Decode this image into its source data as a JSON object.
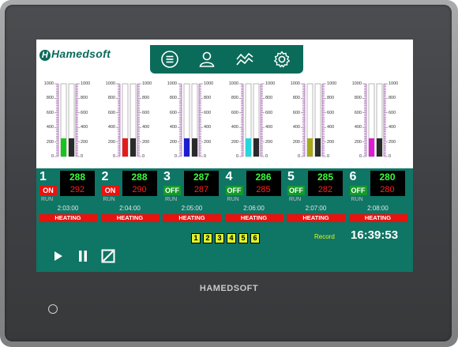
{
  "brand": {
    "logo_text": "Hamedsoft",
    "bezel_text": "HAMEDSOFT"
  },
  "toolbar": {
    "icons": [
      "menu-icon",
      "user-icon",
      "trend-icon",
      "gear-icon"
    ]
  },
  "gauges": {
    "scale_ticks": [
      "1000",
      "800",
      "600",
      "400",
      "200",
      "0"
    ],
    "items": [
      {
        "color": "#18c41b",
        "level": 0.25,
        "set_level": 0.25
      },
      {
        "color": "#e41b1b",
        "level": 0.25,
        "set_level": 0.25
      },
      {
        "color": "#1c1ccf",
        "level": 0.25,
        "set_level": 0.25
      },
      {
        "color": "#27d6dc",
        "level": 0.25,
        "set_level": 0.25
      },
      {
        "color": "#a7a71b",
        "level": 0.25,
        "set_level": 0.25
      },
      {
        "color": "#e01bd6",
        "level": 0.25,
        "set_level": 0.25
      }
    ]
  },
  "channels": [
    {
      "num": "1",
      "sp": "288",
      "pv": "292",
      "state": "ON",
      "state_color": "#e8120f",
      "run": "RUN",
      "time": "2:03:00",
      "status": "HEATING"
    },
    {
      "num": "2",
      "sp": "288",
      "pv": "290",
      "state": "ON",
      "state_color": "#e8120f",
      "run": "RUN",
      "time": "2:04:00",
      "status": "HEATING"
    },
    {
      "num": "3",
      "sp": "287",
      "pv": "287",
      "state": "OFF",
      "state_color": "#139a2a",
      "run": "RUN",
      "time": "2:05:00",
      "status": "HEATING"
    },
    {
      "num": "4",
      "sp": "286",
      "pv": "285",
      "state": "OFF",
      "state_color": "#139a2a",
      "run": "RUN",
      "time": "2:06:00",
      "status": "HEATING"
    },
    {
      "num": "5",
      "sp": "285",
      "pv": "282",
      "state": "OFF",
      "state_color": "#139a2a",
      "run": "RUN",
      "time": "2:07:00",
      "status": "HEATING"
    },
    {
      "num": "6",
      "sp": "280",
      "pv": "280",
      "state": "OFF",
      "state_color": "#139a2a",
      "run": "RUN",
      "time": "2:08:00",
      "status": "HEATING"
    }
  ],
  "pages": [
    "1",
    "2",
    "3",
    "4",
    "5",
    "6"
  ],
  "record_label": "Record",
  "clock": "16:39:53",
  "controls": [
    "play-icon",
    "pause-icon",
    "stop-icon"
  ]
}
